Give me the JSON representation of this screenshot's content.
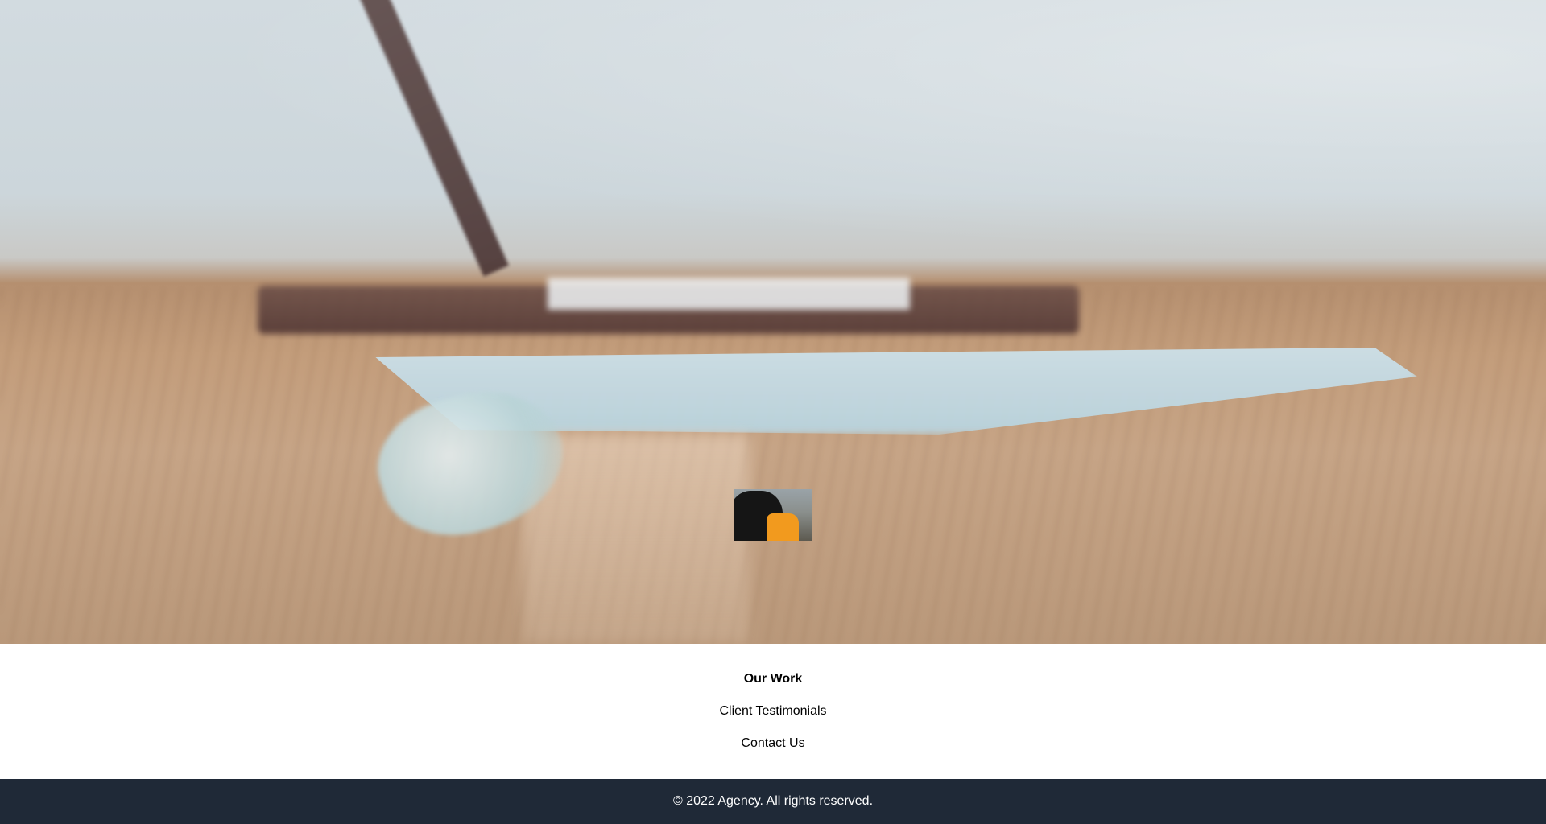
{
  "hero": {
    "thumbnail_alt": "person in black and orange jacket"
  },
  "nav": {
    "items": [
      {
        "label": "Our Work",
        "active": true
      },
      {
        "label": "Client Testimonials",
        "active": false
      },
      {
        "label": "Contact Us",
        "active": false
      }
    ]
  },
  "footer": {
    "copyright": "© 2022 Agency. All rights reserved."
  },
  "colors": {
    "footer_bg": "#1f2937",
    "footer_text": "#ffffff",
    "link_text": "#000000"
  }
}
